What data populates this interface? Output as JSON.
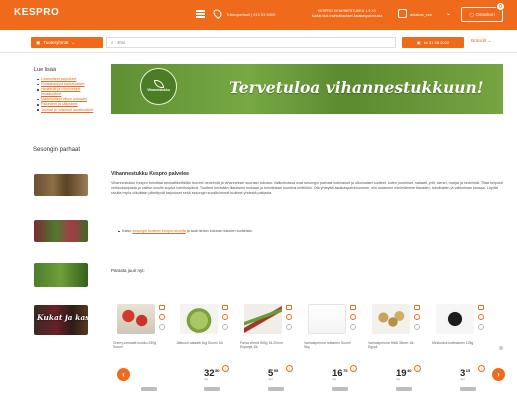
{
  "header": {
    "logo": "KESPRO",
    "logo_sub": "",
    "store": "Tukkuportaali | 010 53 5000",
    "notice_line1": "KESPRO VIHANNESTUKKU 1.9.XX",
    "notice_line2": "Kaikki lisä-/vaihtotilaukset Asiakaspalvelusta",
    "user": "asiakas_xxx",
    "cart_label": "Ostoskori",
    "cart_count": "0"
  },
  "searchbar": {
    "assortment_label": "Tuoteryhmät",
    "search_placeholder": "Etsi",
    "date_label": "ke 31.08.2022",
    "browse_label": "Brändit"
  },
  "sidebar": {
    "title": "Lue lisää",
    "links": [
      "Lihatuotteet tarjoukset",
      "Ruokakauppa kausituotteet",
      "Hedelmät ja vihannekset kausituotteet",
      "Maitotuotteet viikon uutuudet",
      "Pakasteet ja säilykkeet",
      "Juomat ja makeiset kausituotteet"
    ],
    "season_heading": "Sesongin parhaat",
    "thumbs": [
      {
        "label": ""
      },
      {
        "label": ""
      },
      {
        "label": ""
      },
      {
        "label": "Kukat ja kasvit"
      }
    ]
  },
  "banner": {
    "badge_text": "Vihannestukku",
    "headline": "Tervetuloa vihannestukkuun!"
  },
  "intro": {
    "title": "Vihannestukku Kespro palvelee",
    "body": "Vihannestukku Kespro toimittaa ammattikeittiöille tuoreet hedelmät ja vihannekset suoraan tukusta. Valikoimassa ovat sesongin parhaat kotimaiset ja ulkomaiset tuotteet, kuten juurekset, salaatit, yrtit, sienet, marjat ja hedelmät. Tilaa helposti verkkokaupasta ja valitse sinulle sopiva toimituspäivä. Tuotteet kerätään tilauksesi mukaan ja toimitetaan tuoreina keittiöösi. Ota yhteyttä asiakaspalveluumme, niin autamme mielellämme tilausten, toimitusten ja valikoiman kanssa. Löydät sivulta myös viikoittain päivittyvät tarjoukset sekä sesongin suosituimmat tuotteet yhdestä paikasta.",
    "bullet_prefix": "Katso",
    "bullet_link": "sesongin tuotteet Kespro-sivuilta",
    "bullet_suffix": "ja saat tiedon kuluvan kauden tuotteista."
  },
  "products_section": {
    "title": "Parasta juuri nyt:"
  },
  "products": [
    {
      "name": "Cherry-tomaatti ruukku 250g Suomi",
      "price_main": "",
      "price_sub": "",
      "unit": "",
      "badge": ""
    },
    {
      "name": "Jäävuori-salaatti 1kg Suomi 1lk",
      "price_main": "32",
      "price_sub": "50",
      "unit": "/kg",
      "badge": ""
    },
    {
      "name": "Parsa vihreä 500g 16-20mm Espanja 1lk",
      "price_main": "5",
      "price_sub": "95",
      "unit": "/kpl",
      "badge": ""
    },
    {
      "name": "Varhaisperuna nuttanen Suomi 5kg",
      "price_main": "16",
      "price_sub": "75",
      "unit": "/kg",
      "badge": ""
    },
    {
      "name": "Varhaisperuna Hätä 35mm 1lk Egypti",
      "price_main": "19",
      "price_sub": "40",
      "unit": "/kg",
      "badge": ""
    },
    {
      "name": "Minikurkut kotimainen 125g",
      "price_main": "3",
      "price_sub": "15",
      "unit": "/kpl",
      "badge": ""
    }
  ],
  "colors": {
    "brand": "#f06a1b",
    "banner_green": "#6a9b3a"
  },
  "icons": {
    "list": "list-icon",
    "pin": "location-pin-icon",
    "user": "user-icon",
    "cart": "cart-icon",
    "search": "search-icon",
    "calendar": "calendar-icon",
    "prev": "chevron-left-icon",
    "next": "chevron-right-icon"
  }
}
